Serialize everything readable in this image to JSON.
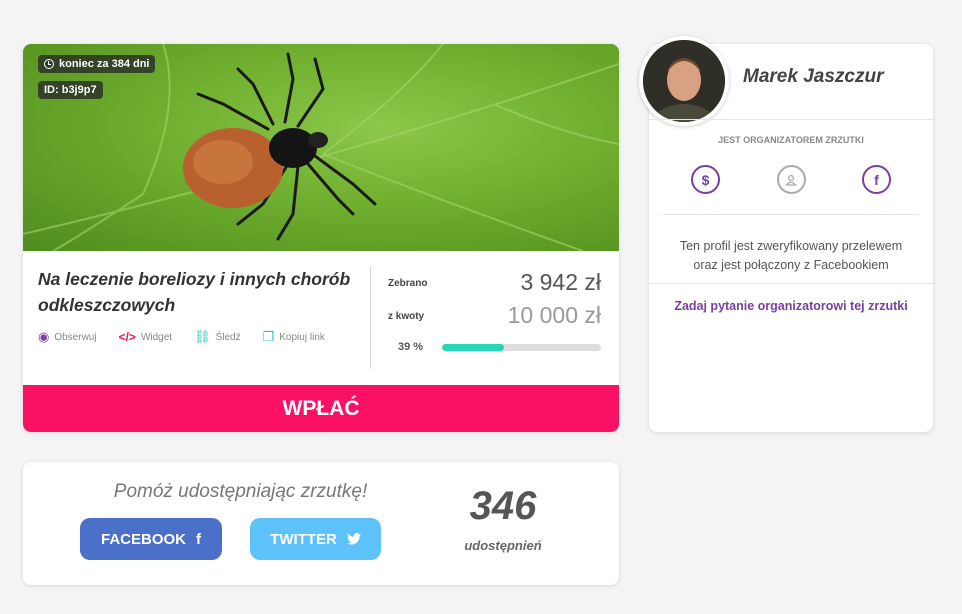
{
  "campaign": {
    "end_label": "koniec za 384 dni",
    "id_label": "ID: b3j9p7",
    "title": "Na leczenie boreliozy i innych chorób odkleszczowych",
    "actions": [
      {
        "icon": "eye-icon",
        "label": "Obserwuj"
      },
      {
        "icon": "code-icon",
        "label": "Widget"
      },
      {
        "icon": "link-icon",
        "label": "Śledź"
      },
      {
        "icon": "copy-icon",
        "label": "Kopiuj link"
      }
    ],
    "raised_label": "Zebrano",
    "raised_value": "3 942 zł",
    "goal_label": "z kwoty",
    "goal_value": "10 000 zł",
    "percent_label": "39 %",
    "progress": 0.39,
    "pay_label": "WPŁAĆ"
  },
  "share": {
    "heading": "Pomóż udostępniając zrzutkę!",
    "facebook_label": "FACEBOOK",
    "twitter_label": "TWITTER",
    "count": "346",
    "count_label": "udostępnień"
  },
  "organizer": {
    "name": "Marek Jaszczur",
    "role": "JEST ORGANIZATOREM ZRZUTKI",
    "icons": [
      "dollar-icon",
      "person-icon",
      "facebook-icon"
    ],
    "verified_line1": "Ten profil jest zweryfikowany przelewem",
    "verified_line2": "oraz jest połączony z Facebookiem",
    "ask_label": "Zadaj pytanie organizatorowi tej zrzutki"
  },
  "colors": {
    "accent_pink": "#fb1164",
    "accent_purple": "#7a3fa0",
    "progress_teal": "#26d7b5",
    "facebook_blue": "#4b70c9",
    "twitter_blue": "#5ec2fa"
  }
}
